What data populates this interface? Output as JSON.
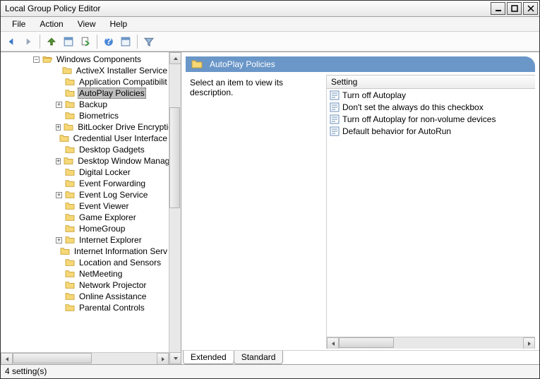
{
  "window": {
    "title": "Local Group Policy Editor"
  },
  "menu": {
    "file": "File",
    "action": "Action",
    "view": "View",
    "help": "Help"
  },
  "tree": {
    "root": {
      "label": "Windows Components",
      "expanded": true
    },
    "items": [
      {
        "label": "ActiveX Installer Service",
        "expandable": false
      },
      {
        "label": "Application Compatibilit",
        "expandable": false
      },
      {
        "label": "AutoPlay Policies",
        "expandable": false,
        "selected": true
      },
      {
        "label": "Backup",
        "expandable": true
      },
      {
        "label": "Biometrics",
        "expandable": false
      },
      {
        "label": "BitLocker Drive Encryption",
        "expandable": true
      },
      {
        "label": "Credential User Interface",
        "expandable": false
      },
      {
        "label": "Desktop Gadgets",
        "expandable": false
      },
      {
        "label": "Desktop Window Manag",
        "expandable": true
      },
      {
        "label": "Digital Locker",
        "expandable": false
      },
      {
        "label": "Event Forwarding",
        "expandable": false
      },
      {
        "label": "Event Log Service",
        "expandable": true
      },
      {
        "label": "Event Viewer",
        "expandable": false
      },
      {
        "label": "Game Explorer",
        "expandable": false
      },
      {
        "label": "HomeGroup",
        "expandable": false
      },
      {
        "label": "Internet Explorer",
        "expandable": true
      },
      {
        "label": "Internet Information Serv",
        "expandable": false
      },
      {
        "label": "Location and Sensors",
        "expandable": false
      },
      {
        "label": "NetMeeting",
        "expandable": false
      },
      {
        "label": "Network Projector",
        "expandable": false
      },
      {
        "label": "Online Assistance",
        "expandable": false
      },
      {
        "label": "Parental Controls",
        "expandable": false
      }
    ]
  },
  "detail": {
    "heading": "AutoPlay Policies",
    "description": "Select an item to view its description.",
    "column_header": "Setting",
    "settings": [
      "Turn off Autoplay",
      "Don't set the always do this checkbox",
      "Turn off Autoplay for non-volume devices",
      "Default behavior for AutoRun"
    ]
  },
  "tabs": {
    "extended": "Extended",
    "standard": "Standard"
  },
  "statusbar": "4 setting(s)"
}
